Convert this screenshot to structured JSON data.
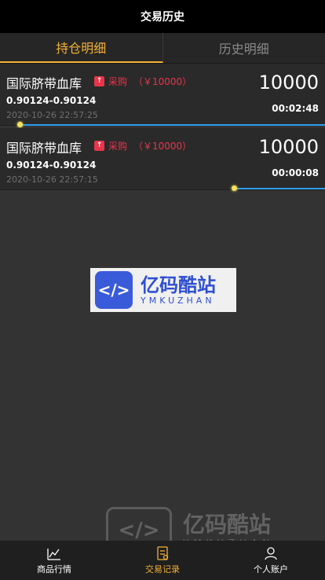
{
  "header": {
    "title": "交易历史"
  },
  "tabs": [
    {
      "label": "持仓明细",
      "active": true
    },
    {
      "label": "历史明细",
      "active": false
    }
  ],
  "positions": [
    {
      "name": "国际脐带血库",
      "tag_icon": "up-arrow-icon",
      "action": "采购",
      "qty": "（￥10000）",
      "range": "0.90124-0.90124",
      "time": "2020-10-26 22:57:25",
      "amount": "10000",
      "countdown": "00:02:48",
      "progress": 0.06
    },
    {
      "name": "国际脐带血库",
      "tag_icon": "up-arrow-icon",
      "action": "采购",
      "qty": "（￥10000）",
      "range": "0.90124-0.90124",
      "time": "2020-10-26 22:57:15",
      "amount": "10000",
      "countdown": "00:00:08",
      "progress": 0.72
    }
  ],
  "logo": {
    "text": "亿码酷站",
    "sub": "YMKUZHAN"
  },
  "watermark": {
    "text": "亿码酷站",
    "sub": "YMKUZHAN"
  },
  "nav": [
    {
      "label": "商品行情",
      "icon": "chart-icon",
      "active": false
    },
    {
      "label": "交易记录",
      "icon": "record-icon",
      "active": true
    },
    {
      "label": "个人账户",
      "icon": "user-icon",
      "active": false
    }
  ],
  "colors": {
    "accent": "#f4b133",
    "buy": "#e8354a",
    "progress_line": "#2d9df0",
    "progress_dot": "#f8e15b"
  }
}
